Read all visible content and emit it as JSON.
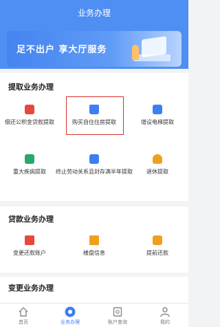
{
  "header": {
    "title": "业务办理"
  },
  "banner": {
    "text": "足不出户 享大厅服务"
  },
  "sections": [
    {
      "title": "提取业务办理",
      "items": [
        {
          "label": "偿还公积金贷款提取",
          "icon": "loan-repay-icon",
          "color": "#e8483c"
        },
        {
          "label": "购买自住住房提取",
          "icon": "house-icon",
          "color": "#3d7ef0"
        },
        {
          "label": "增设电梯提取",
          "icon": "elevator-icon",
          "color": "#3d7ef0"
        },
        {
          "label": "重大疾病提取",
          "icon": "medical-icon",
          "color": "#2aa86a"
        },
        {
          "label": "终止劳动关系且封存满半年提取",
          "icon": "contract-icon",
          "color": "#3d7ef0"
        },
        {
          "label": "退休提取",
          "icon": "retire-icon",
          "color": "#f0a020"
        }
      ]
    },
    {
      "title": "贷款业务办理",
      "items": [
        {
          "label": "变更还款账户",
          "icon": "account-icon",
          "color": "#e8483c"
        },
        {
          "label": "楼盘信息",
          "icon": "building-icon",
          "color": "#f0a020"
        },
        {
          "label": "提前还款",
          "icon": "prepay-icon",
          "color": "#f0a020"
        }
      ]
    },
    {
      "title": "变更业务办理",
      "items": []
    }
  ],
  "tabbar": [
    {
      "label": "首页",
      "icon": "home-icon",
      "active": false
    },
    {
      "label": "业务办理",
      "icon": "service-icon",
      "active": true
    },
    {
      "label": "账户查询",
      "icon": "account-query-icon",
      "active": false
    },
    {
      "label": "我的",
      "icon": "user-icon",
      "active": false
    }
  ],
  "colors": {
    "primary": "#4f8ef2",
    "highlight_border": "#d9302a",
    "active_tab": "#3d7ef0"
  }
}
